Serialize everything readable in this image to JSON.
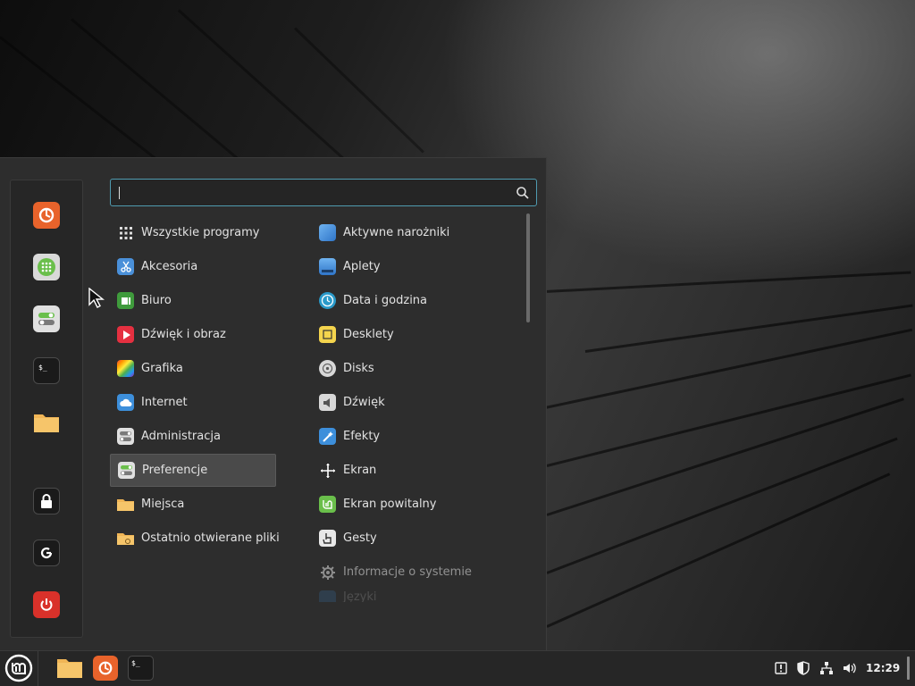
{
  "search": {
    "placeholder": "",
    "value": ""
  },
  "sidebar": {
    "favorites": [
      {
        "name": "firefox",
        "icon": "firefox-icon"
      },
      {
        "name": "software-manager",
        "icon": "software-manager-icon"
      },
      {
        "name": "settings",
        "icon": "toggle-settings-icon"
      },
      {
        "name": "terminal",
        "icon": "terminal-icon"
      },
      {
        "name": "files",
        "icon": "folder-icon"
      }
    ],
    "session": [
      {
        "name": "lock",
        "icon": "lock-icon"
      },
      {
        "name": "logout",
        "icon": "logout-icon"
      },
      {
        "name": "shutdown",
        "icon": "power-icon"
      }
    ]
  },
  "categories": [
    {
      "label": "Wszystkie programy",
      "icon": "grid-icon"
    },
    {
      "label": "Akcesoria",
      "icon": "scissors-icon"
    },
    {
      "label": "Biuro",
      "icon": "office-icon"
    },
    {
      "label": "Dźwięk i obraz",
      "icon": "play-icon"
    },
    {
      "label": "Grafika",
      "icon": "graphics-icon"
    },
    {
      "label": "Internet",
      "icon": "cloud-icon"
    },
    {
      "label": "Administracja",
      "icon": "admin-toggle-icon"
    },
    {
      "label": "Preferencje",
      "icon": "preferences-toggle-icon"
    },
    {
      "label": "Miejsca",
      "icon": "folder-icon"
    },
    {
      "label": "Ostatnio otwierane pliki",
      "icon": "recent-folder-icon"
    }
  ],
  "selected_category": "Preferencje",
  "apps": [
    {
      "label": "Aktywne narożniki",
      "icon": "hot-corners-icon"
    },
    {
      "label": "Aplety",
      "icon": "applets-icon"
    },
    {
      "label": "Data i godzina",
      "icon": "clock-icon"
    },
    {
      "label": "Desklety",
      "icon": "desklets-icon"
    },
    {
      "label": "Disks",
      "icon": "disks-icon"
    },
    {
      "label": "Dźwięk",
      "icon": "speaker-icon"
    },
    {
      "label": "Efekty",
      "icon": "effects-icon"
    },
    {
      "label": "Ekran",
      "icon": "display-icon"
    },
    {
      "label": "Ekran powitalny",
      "icon": "welcome-icon"
    },
    {
      "label": "Gesty",
      "icon": "gestures-icon"
    },
    {
      "label": "Informacje o systemie",
      "icon": "system-info-icon"
    },
    {
      "label": "Języki",
      "icon": "languages-icon"
    }
  ],
  "taskbar": {
    "menu_icon": "linux-mint-logo-icon",
    "launchers": [
      "folder-icon",
      "firefox-icon",
      "terminal-icon"
    ],
    "tray": [
      "notifications-icon",
      "update-shield-icon",
      "network-icon",
      "volume-icon"
    ],
    "clock": "12:29"
  },
  "colors": {
    "accent": "#4f9bb0",
    "panel_bg": "#2d2d2d",
    "mint_green": "#6abf4b"
  }
}
